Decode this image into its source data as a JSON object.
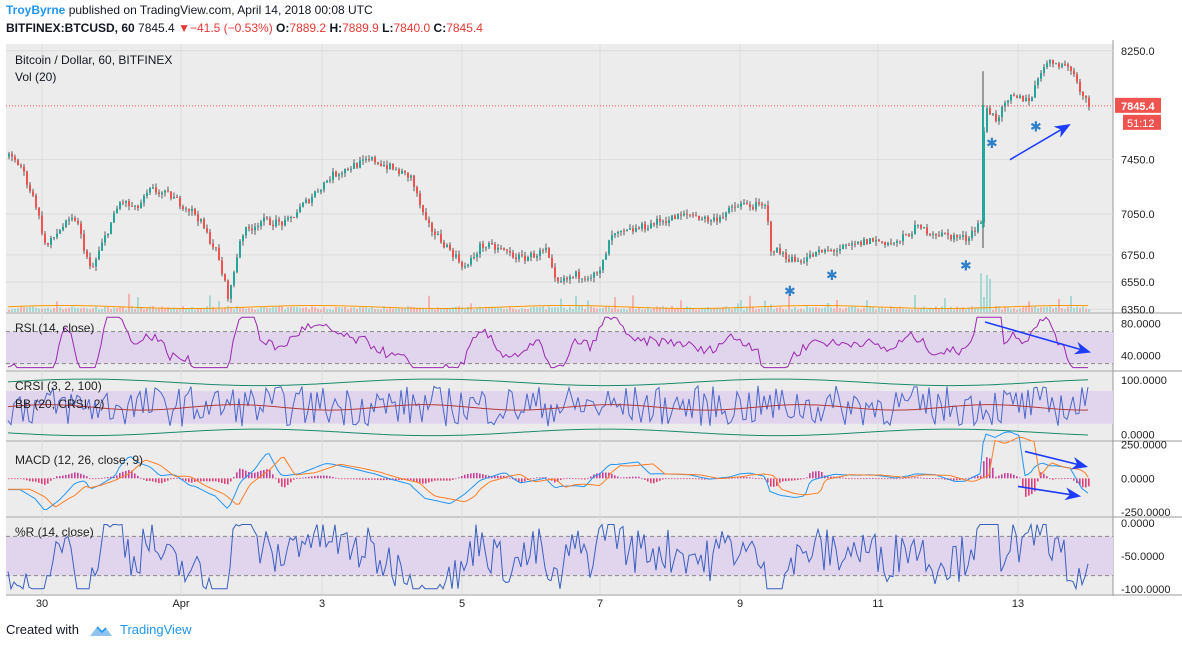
{
  "header": {
    "author": "TroyByrne",
    "published_text": "published on TradingView.com, April 14, 2018 00:08 UTC",
    "symbol": "BITFINEX:BTCUSD, 60",
    "last": "7845.4",
    "change": "−41.5 (−0.53%)",
    "ohlc": {
      "o_label": "O:",
      "o": "7889.2",
      "h_label": "H:",
      "h": "7889.9",
      "l_label": "L:",
      "l": "7840.0",
      "c_label": "C:",
      "c": "7845.4"
    }
  },
  "footer": {
    "created_with": "Created with",
    "brand": "TradingView"
  },
  "colors": {
    "up": "#26a69a",
    "down": "#ef5350",
    "bg": "#ececec",
    "band": "#e1d5ee",
    "annotation": "#1e3cff",
    "star": "#2f7fc9",
    "last_price": "#ef5350"
  },
  "chart_data": {
    "type": "candlestick_with_indicators",
    "price_pane": {
      "title": "Bitcoin / Dollar, 60, BITFINEX",
      "volume_label": "Vol (20)",
      "y_ticks": [
        "8250.0",
        "7450.0",
        "7050.0",
        "6750.0",
        "6550.0",
        "6350.0"
      ],
      "y_tick_values": [
        8250,
        7450,
        7050,
        6750,
        6550,
        6350
      ],
      "ylim": [
        6330,
        8300
      ],
      "last_price_tag": "7845.4",
      "countdown_tag": "51:12",
      "price_path": [
        [
          0,
          7520
        ],
        [
          20,
          7400
        ],
        [
          35,
          7120
        ],
        [
          45,
          6800
        ],
        [
          60,
          6950
        ],
        [
          75,
          7020
        ],
        [
          90,
          6620
        ],
        [
          105,
          6900
        ],
        [
          120,
          7150
        ],
        [
          135,
          7080
        ],
        [
          150,
          7230
        ],
        [
          170,
          7180
        ],
        [
          195,
          7050
        ],
        [
          215,
          6780
        ],
        [
          228,
          6430
        ],
        [
          240,
          6900
        ],
        [
          260,
          7000
        ],
        [
          285,
          6980
        ],
        [
          300,
          7100
        ],
        [
          330,
          7330
        ],
        [
          350,
          7400
        ],
        [
          372,
          7450
        ],
        [
          392,
          7380
        ],
        [
          410,
          7320
        ],
        [
          425,
          6980
        ],
        [
          445,
          6820
        ],
        [
          465,
          6650
        ],
        [
          480,
          6820
        ],
        [
          500,
          6790
        ],
        [
          520,
          6720
        ],
        [
          545,
          6780
        ],
        [
          555,
          6530
        ],
        [
          575,
          6600
        ],
        [
          598,
          6600
        ],
        [
          610,
          6880
        ],
        [
          640,
          6950
        ],
        [
          660,
          7000
        ],
        [
          690,
          7050
        ],
        [
          710,
          7000
        ],
        [
          740,
          7120
        ],
        [
          765,
          7100
        ],
        [
          770,
          6800
        ],
        [
          795,
          6700
        ],
        [
          820,
          6770
        ],
        [
          845,
          6800
        ],
        [
          870,
          6860
        ],
        [
          895,
          6830
        ],
        [
          915,
          6950
        ],
        [
          940,
          6900
        ],
        [
          965,
          6870
        ],
        [
          980,
          7000
        ],
        [
          984,
          7850
        ],
        [
          995,
          7750
        ],
        [
          1010,
          7900
        ],
        [
          1030,
          7900
        ],
        [
          1042,
          8150
        ],
        [
          1055,
          8170
        ],
        [
          1070,
          8120
        ],
        [
          1080,
          7960
        ],
        [
          1088,
          7845
        ]
      ],
      "annotations": [
        {
          "type": "star",
          "x": 992,
          "y": 7580
        },
        {
          "type": "star",
          "x": 1036,
          "y": 7700
        },
        {
          "type": "star",
          "x": 966,
          "y": 6680
        },
        {
          "type": "star",
          "x": 790,
          "y": 6490
        },
        {
          "type": "star",
          "x": 832,
          "y": 6610
        },
        {
          "type": "arrow",
          "from": [
            1010,
            7450
          ],
          "to": [
            1068,
            7700
          ]
        }
      ]
    },
    "rsi_pane": {
      "title": "RSI (14, close)",
      "y_ticks": [
        "80.0000",
        "40.0000"
      ],
      "y_tick_values": [
        80,
        40
      ],
      "ylim": [
        22,
        92
      ],
      "upper_band": 70,
      "lower_band": 30,
      "arrow": {
        "from": [
          985,
          82
        ],
        "to": [
          1088,
          45
        ]
      }
    },
    "crsi_pane": {
      "title": "CRSI (3, 2, 100)",
      "bb_label": "BB (20, CRSI, 2)",
      "y_ticks": [
        "100.0000",
        "0.0000"
      ],
      "y_tick_values": [
        100,
        0
      ],
      "ylim": [
        -10,
        115
      ],
      "upper_band": 80,
      "lower_band": 20
    },
    "macd_pane": {
      "title": "MACD (12, 26, close, 9)",
      "y_ticks": [
        "250.0000",
        "0.0000",
        "-250.0000"
      ],
      "y_tick_values": [
        250,
        0,
        -250
      ],
      "ylim": [
        -280,
        270
      ],
      "arrows": [
        {
          "from": [
            1025,
            200
          ],
          "to": [
            1085,
            90
          ]
        },
        {
          "from": [
            1018,
            -60
          ],
          "to": [
            1078,
            -130
          ]
        }
      ]
    },
    "wr_pane": {
      "title": "%R (14, close)",
      "y_ticks": [
        "0.0000",
        "-50.0000",
        "-100.0000"
      ],
      "y_tick_values": [
        0,
        -50,
        -100
      ],
      "ylim": [
        -108,
        8
      ],
      "upper_band": -20,
      "lower_band": -80
    },
    "x_axis": {
      "labels": [
        "30",
        "Apr",
        "3",
        "5",
        "7",
        "9",
        "11",
        "13"
      ],
      "positions": [
        42,
        181,
        322,
        462,
        600,
        740,
        878,
        1018
      ]
    }
  }
}
